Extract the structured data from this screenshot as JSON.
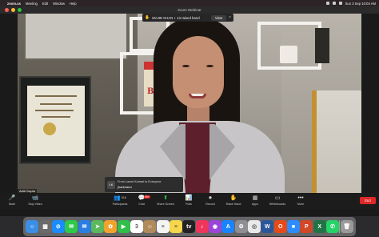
{
  "menubar": {
    "apple_icon": "apple-icon",
    "app_name": "zoom.us",
    "items": [
      "Meeting",
      "Edit",
      "Window",
      "Help"
    ],
    "datetime": "Sun 3 Sep 10:04 AM"
  },
  "window": {
    "title": "Zoom Webinar",
    "traffic_lights": [
      "#ff5f57",
      "#febc2e",
      "#28c840"
    ]
  },
  "notification": {
    "text": "MAJID KHAN + 13 raised hand",
    "view_label": "View",
    "close_icon": "close-icon",
    "hand_icon": "hand-icon"
  },
  "scene": {
    "book_title": "THE MAGIC OF THINKING",
    "book_big": "BIG"
  },
  "chat": {
    "avatar_initials": "LK",
    "from": "From Laxmi Kumari to Everyone",
    "message": "jharkhand"
  },
  "name_tag": "Aditi Gupta",
  "controls": [
    {
      "label": "Mute",
      "icon": "microphone-icon",
      "glyph": "🎤"
    },
    {
      "label": "Stop Video",
      "icon": "video-camera-icon",
      "glyph": "📹"
    },
    {
      "label": "Participants",
      "icon": "participants-icon",
      "glyph": "👥",
      "count": "516"
    },
    {
      "label": "Chat",
      "icon": "chat-icon",
      "glyph": "💬",
      "badge": "99+"
    },
    {
      "label": "Share Screen",
      "icon": "share-screen-icon",
      "glyph": "⬆"
    },
    {
      "label": "Polls",
      "icon": "polls-icon",
      "glyph": "📊"
    },
    {
      "label": "Record",
      "icon": "record-icon",
      "glyph": "⏺"
    },
    {
      "label": "Raise Hand",
      "icon": "raise-hand-icon",
      "glyph": "✋"
    },
    {
      "label": "Apps",
      "icon": "apps-icon",
      "glyph": "▦"
    },
    {
      "label": "Whiteboards",
      "icon": "whiteboard-icon",
      "glyph": "▭"
    },
    {
      "label": "More",
      "icon": "more-icon",
      "glyph": "•••"
    }
  ],
  "end_label": "End",
  "dock": [
    {
      "name": "finder-icon",
      "color": "#3a8ee6",
      "glyph": "☺"
    },
    {
      "name": "launchpad-icon",
      "color": "#6b6b6b",
      "glyph": "▦"
    },
    {
      "name": "safari-icon",
      "color": "#1a8cff",
      "glyph": "⊘"
    },
    {
      "name": "messages-icon",
      "color": "#2fc94a",
      "glyph": "✉"
    },
    {
      "name": "mail-icon",
      "color": "#2a7de1",
      "glyph": "✉"
    },
    {
      "name": "maps-icon",
      "color": "#5cb85c",
      "glyph": "➤"
    },
    {
      "name": "photos-icon",
      "color": "#f2a32b",
      "glyph": "✿"
    },
    {
      "name": "facetime-icon",
      "color": "#2fbf4a",
      "glyph": "▶"
    },
    {
      "name": "calendar-icon",
      "color": "#ffffff",
      "glyph": "3"
    },
    {
      "name": "contacts-icon",
      "color": "#b08a5a",
      "glyph": "☺"
    },
    {
      "name": "reminders-icon",
      "color": "#f4f4f4",
      "glyph": "≡"
    },
    {
      "name": "notes-icon",
      "color": "#f6d74a",
      "glyph": "≡"
    },
    {
      "name": "tv-icon",
      "color": "#222222",
      "glyph": "tv"
    },
    {
      "name": "music-icon",
      "color": "#f0355a",
      "glyph": "♪"
    },
    {
      "name": "podcasts-icon",
      "color": "#9b45d8",
      "glyph": "◉"
    },
    {
      "name": "app-store-icon",
      "color": "#1a84ff",
      "glyph": "A"
    },
    {
      "name": "system-settings-icon",
      "color": "#8e8e93",
      "glyph": "⚙"
    },
    {
      "name": "chrome-icon",
      "color": "#e9e9e9",
      "glyph": "◎"
    },
    {
      "name": "word-icon",
      "color": "#2b579a",
      "glyph": "W"
    },
    {
      "name": "office-icon",
      "color": "#e64a19",
      "glyph": "O"
    },
    {
      "name": "zoom-icon",
      "color": "#2d8cff",
      "glyph": "■"
    },
    {
      "name": "powerpoint-icon",
      "color": "#d24726",
      "glyph": "P"
    },
    {
      "name": "excel-icon",
      "color": "#217346",
      "glyph": "X"
    },
    {
      "name": "whatsapp-icon",
      "color": "#25d366",
      "glyph": "✆"
    },
    {
      "name": "trash-icon",
      "color": "#9a9a9a",
      "glyph": "🗑"
    }
  ]
}
